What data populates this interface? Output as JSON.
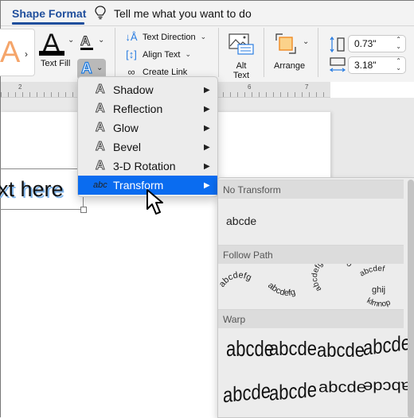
{
  "tabbar": {
    "active_tab": "Shape Format",
    "tell_me": "Tell me what you want to do"
  },
  "ribbon": {
    "text_fill_label": "Text Fill",
    "text_direction": "Text Direction",
    "align_text": "Align Text",
    "create_link": "Create Link",
    "alt_text_line1": "Alt",
    "alt_text_line2": "Text",
    "arrange": "Arrange",
    "height_value": "0.73\"",
    "width_value": "3.18\""
  },
  "ruler": {
    "labels": [
      "2",
      "6",
      "7"
    ]
  },
  "document": {
    "textbox_text": "xt here"
  },
  "menu": {
    "items": [
      {
        "label": "Shadow",
        "icon": "A"
      },
      {
        "label": "Reflection",
        "icon": "A"
      },
      {
        "label": "Glow",
        "icon": "A"
      },
      {
        "label": "Bevel",
        "icon": "A"
      },
      {
        "label": "3-D Rotation",
        "icon": "A"
      },
      {
        "label": "Transform",
        "icon": "abc",
        "active": true
      }
    ],
    "arrow": "▶"
  },
  "submenu": {
    "sections": [
      {
        "title": "No Transform",
        "samples": [
          "abcde"
        ]
      },
      {
        "title": "Follow Path",
        "samples": [
          "abcdefg",
          "abcdefg",
          "abcdefghijklmno",
          "abcdef ghij klmnop"
        ]
      },
      {
        "title": "Warp",
        "samples": [
          "abcde",
          "abcde",
          "abcde",
          "abcde",
          "abcde",
          "abcde",
          "abcde",
          "abcde"
        ]
      }
    ]
  },
  "colors": {
    "accent": "#1f4e9c",
    "menu_highlight": "#0a6cf0",
    "effects_blue": "#1e7be0"
  }
}
